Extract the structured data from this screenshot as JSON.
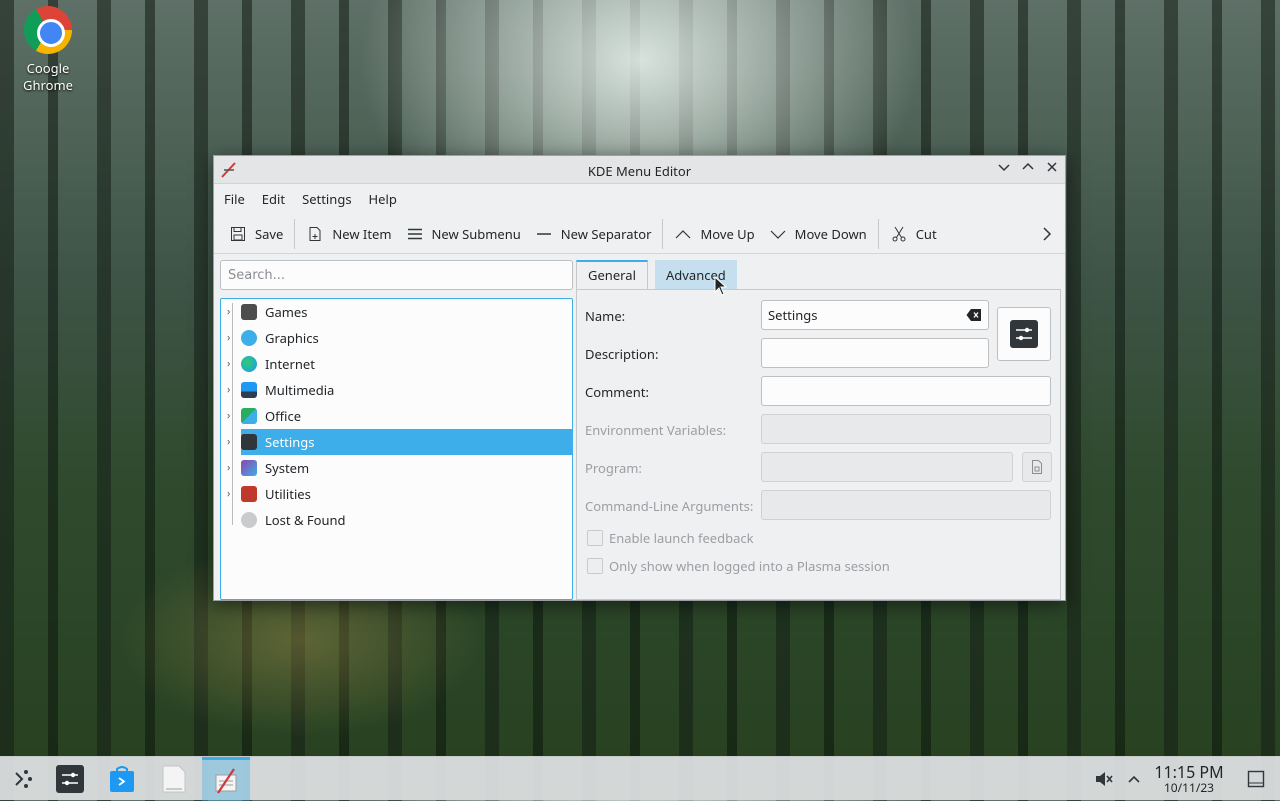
{
  "desktop": {
    "icon_label": "Coogle Ghrome"
  },
  "window": {
    "title": "KDE Menu Editor",
    "menus": [
      "File",
      "Edit",
      "Settings",
      "Help"
    ],
    "toolbar": {
      "save": "Save",
      "new_item": "New Item",
      "new_submenu": "New Submenu",
      "new_separator": "New Separator",
      "move_up": "Move Up",
      "move_down": "Move Down",
      "cut": "Cut"
    },
    "search_placeholder": "Search...",
    "tree": [
      {
        "label": "Games",
        "icon_color": "#4d4d4d"
      },
      {
        "label": "Graphics",
        "icon_color": "#3daee9"
      },
      {
        "label": "Internet",
        "icon_color": "#1d99f3"
      },
      {
        "label": "Multimedia",
        "icon_color": "#2c3e50"
      },
      {
        "label": "Office",
        "icon_color": "#27ae60"
      },
      {
        "label": "Settings",
        "icon_color": "#31363b"
      },
      {
        "label": "System",
        "icon_color": "#8e44ad"
      },
      {
        "label": "Utilities",
        "icon_color": "#c0392b"
      },
      {
        "label": "Lost & Found",
        "icon_color": "#9a9ea2"
      }
    ],
    "tabs": {
      "general": "General",
      "advanced": "Advanced"
    },
    "form": {
      "name_label": "Name:",
      "name_value": "Settings",
      "description_label": "Description:",
      "comment_label": "Comment:",
      "env_label": "Environment Variables:",
      "program_label": "Program:",
      "args_label": "Command-Line Arguments:",
      "launch_feedback": "Enable launch feedback",
      "plasma_only": "Only show when logged into a Plasma session"
    }
  },
  "taskbar": {
    "time": "11:15 PM",
    "date": "10/11/23"
  },
  "colors": {
    "accent": "#3daee9",
    "selection": "#3daee9"
  }
}
